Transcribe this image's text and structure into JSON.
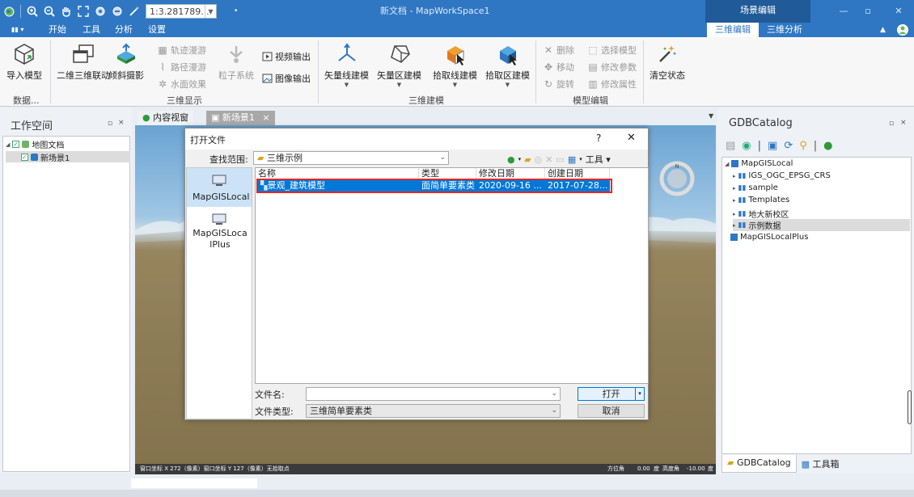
{
  "quick_access": {
    "scale_value": "1:3.281789...",
    "icons": [
      "globe-icon",
      "zoom-in-icon",
      "zoom-out-icon",
      "pan-hand-icon",
      "full-extent-icon",
      "layer-icon",
      "refresh-icon",
      "magic-icon"
    ]
  },
  "window": {
    "title": "新文档 - MapWorkSpace1",
    "context_group": "场景编辑",
    "minimize": "—",
    "maximize": "▫",
    "close": "✕"
  },
  "menu": {
    "app_button": "▮▮",
    "tabs": [
      "开始",
      "工具",
      "分析",
      "设置"
    ],
    "context_tabs": [
      "三维编辑",
      "三维分析"
    ]
  },
  "ribbon": {
    "import_model": "导入模型",
    "data_group": "数据...",
    "linkage_2d3d": "二维三维联动",
    "oblique_photo": "倾斜摄影",
    "track_roam": "轨迹漫游",
    "path_roam": "路径漫游",
    "water_effect": "水面效果",
    "particle_system": "粒子系统",
    "video_output": "视频输出",
    "image_output": "图像输出",
    "group_3d_display": "三维显示",
    "vector_line_model": "矢量线建模",
    "vector_area_model": "矢量区建模",
    "pick_line_model": "拾取线建模",
    "pick_area_model": "拾取区建模",
    "group_3d_model": "三维建模",
    "delete": "删除",
    "move": "移动",
    "rotate": "旋转",
    "select_model": "选择模型",
    "modify_params": "修改参数",
    "modify_attrs": "修改属性",
    "group_model_edit": "模型编辑",
    "clear_state": "清空状态"
  },
  "workspace": {
    "title": "工作空间",
    "pin": "▫",
    "close": "×",
    "tree": [
      {
        "label": "地图文档",
        "level": 0
      },
      {
        "label": "新场景1",
        "level": 1
      }
    ]
  },
  "doc_tabs": [
    {
      "label": "内容视窗",
      "active": false
    },
    {
      "label": "新场景1",
      "active": true
    }
  ],
  "scene": {
    "status_left": "窗口坐标 X 272（像素）窗口坐标 Y 127（像素）无拾取点",
    "status_right_label1": "方位角",
    "status_right_value1": "0.00",
    "status_right_unit1": "度",
    "status_right_label2": "高度角",
    "status_right_value2": "-10.00",
    "status_right_unit2": "度"
  },
  "dialog": {
    "title": "打开文件",
    "help": "?",
    "close": "✕",
    "look_in_label": "查找范围:",
    "look_in_value": "三维示例",
    "tools_label": "工具",
    "places": [
      "MapGISLocal",
      "MapGISLocalPlus"
    ],
    "columns": [
      "名称",
      "类型",
      "修改日期",
      "创建日期"
    ],
    "rows": [
      {
        "name": "景观_建筑模型",
        "type": "面简单要素类",
        "modified": "2020-09-16 ...",
        "created": "2017-07-28..."
      }
    ],
    "filename_label": "文件名:",
    "filename_value": "",
    "filetype_label": "文件类型:",
    "filetype_value": "三维简单要素类",
    "open_button": "打开",
    "cancel_button": "取消"
  },
  "gdb": {
    "title": "GDBCatalog",
    "pin": "▫",
    "close": "×",
    "tree": [
      {
        "label": "MapGISLocal",
        "level": 0
      },
      {
        "label": "IGS_OGC_EPSG_CRS",
        "level": 1
      },
      {
        "label": "sample",
        "level": 1
      },
      {
        "label": "Templates",
        "level": 1
      },
      {
        "label": "地大新校区",
        "level": 1
      },
      {
        "label": "示例数据",
        "level": 1,
        "selected": true
      },
      {
        "label": "MapGISLocalPlus",
        "level": 0
      }
    ],
    "bottom_tabs": [
      "GDBCatalog",
      "工具箱"
    ]
  }
}
